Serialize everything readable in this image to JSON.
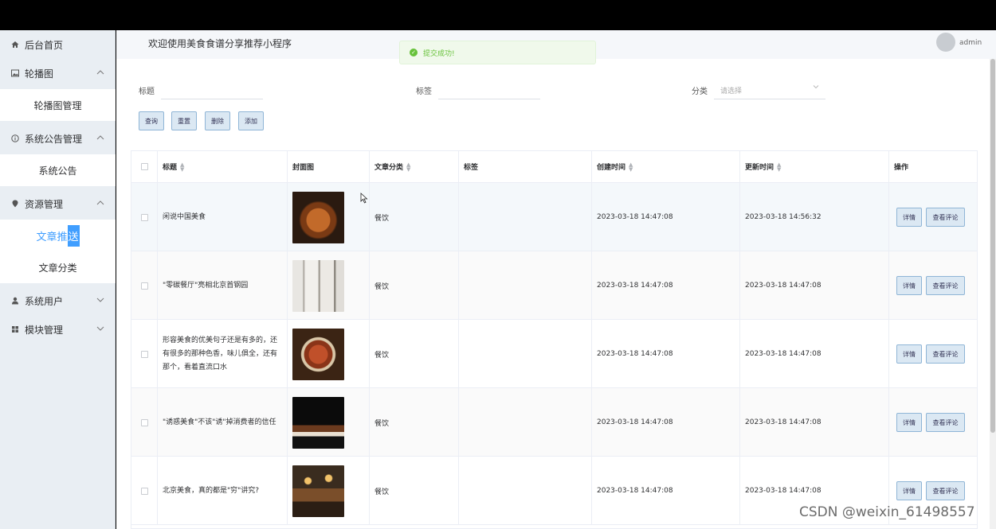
{
  "sidebar": {
    "items": [
      {
        "label": "后台首页",
        "icon": "home-icon"
      },
      {
        "label": "轮播图",
        "icon": "image-icon",
        "expanded": true
      },
      {
        "label": "系统公告管理",
        "icon": "info-icon",
        "expanded": true
      },
      {
        "label": "资源管理",
        "icon": "location-icon",
        "expanded": true
      },
      {
        "label": "系统用户",
        "icon": "user-icon",
        "expanded": false
      },
      {
        "label": "模块管理",
        "icon": "grid-icon",
        "expanded": false
      }
    ],
    "sub": {
      "carousel_manage": "轮播图管理",
      "notice": "系统公告",
      "article_push_a": "文章推",
      "article_push_b": "送",
      "article_category": "文章分类"
    }
  },
  "header": {
    "title": "欢迎使用美食食谱分享推荐小程序",
    "username": "admin"
  },
  "toast": {
    "text": "提交成功!",
    "color": "#67c23a"
  },
  "filters": {
    "title_label": "标题",
    "tag_label": "标签",
    "category_label": "分类",
    "category_placeholder": "请选择"
  },
  "buttons": {
    "query": "查询",
    "reset": "重置",
    "delete": "删除",
    "add": "添加"
  },
  "table": {
    "headers": {
      "title": "标题",
      "cover": "封面图",
      "category": "文章分类",
      "tags": "标签",
      "created": "创建时间",
      "updated": "更新时间",
      "actions": "操作"
    },
    "row_buttons": {
      "detail": "详情",
      "comments": "查看评论"
    },
    "rows": [
      {
        "title": "闲说中国美食",
        "category": "餐饮",
        "tags": "",
        "created": "2023-03-18 14:47:08",
        "updated": "2023-03-18 14:56:32"
      },
      {
        "title": "\"零碳餐厅\"亮相北京首钢园",
        "category": "餐饮",
        "tags": "",
        "created": "2023-03-18 14:47:08",
        "updated": "2023-03-18 14:47:08"
      },
      {
        "title": "形容美食的优美句子还是有多的，还有很多的那种色香，味儿俱全，还有那个，看着直流口水",
        "category": "餐饮",
        "tags": "",
        "created": "2023-03-18 14:47:08",
        "updated": "2023-03-18 14:47:08"
      },
      {
        "title": "\"诱惑美食\"不该\"诱\"掉消费者的信任",
        "category": "餐饮",
        "tags": "",
        "created": "2023-03-18 14:47:08",
        "updated": "2023-03-18 14:47:08"
      },
      {
        "title": "北京美食，真的都是\"穷\"讲究?",
        "category": "餐饮",
        "tags": "",
        "created": "2023-03-18 14:47:08",
        "updated": "2023-03-18 14:47:08"
      }
    ]
  },
  "watermark": "CSDN @weixin_61498557",
  "colors": {
    "accent": "#409eff",
    "sidebar_bg": "#e9eef3",
    "button_bg": "#dbe8f3"
  }
}
